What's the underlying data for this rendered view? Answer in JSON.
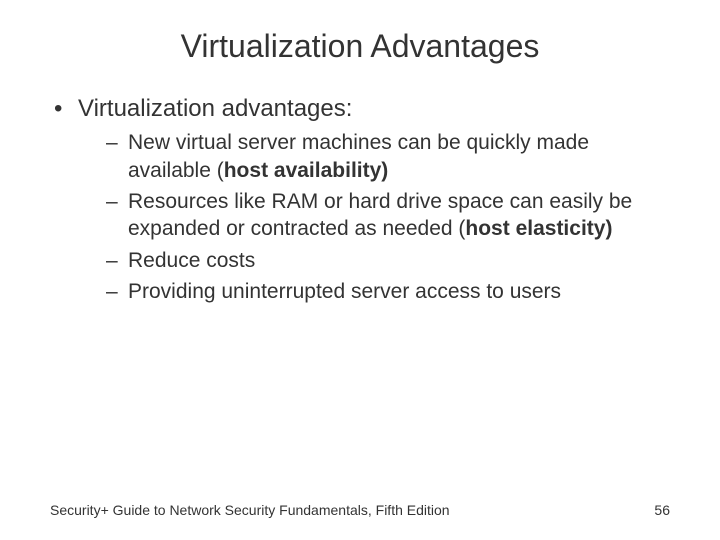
{
  "title": "Virtualization Advantages",
  "bullets": {
    "l1_0": "Virtualization advantages:",
    "l2_0_pre": "New virtual server machines can be quickly made available (",
    "l2_0_bold": "host availability)",
    "l2_1_pre": "Resources like RAM or hard drive space can easily be expanded or contracted as needed (",
    "l2_1_bold": "host elasticity)",
    "l2_2": "Reduce costs",
    "l2_3": "Providing uninterrupted server access to users"
  },
  "footer": {
    "source": "Security+ Guide to Network Security Fundamentals, Fifth Edition",
    "page": "56"
  }
}
